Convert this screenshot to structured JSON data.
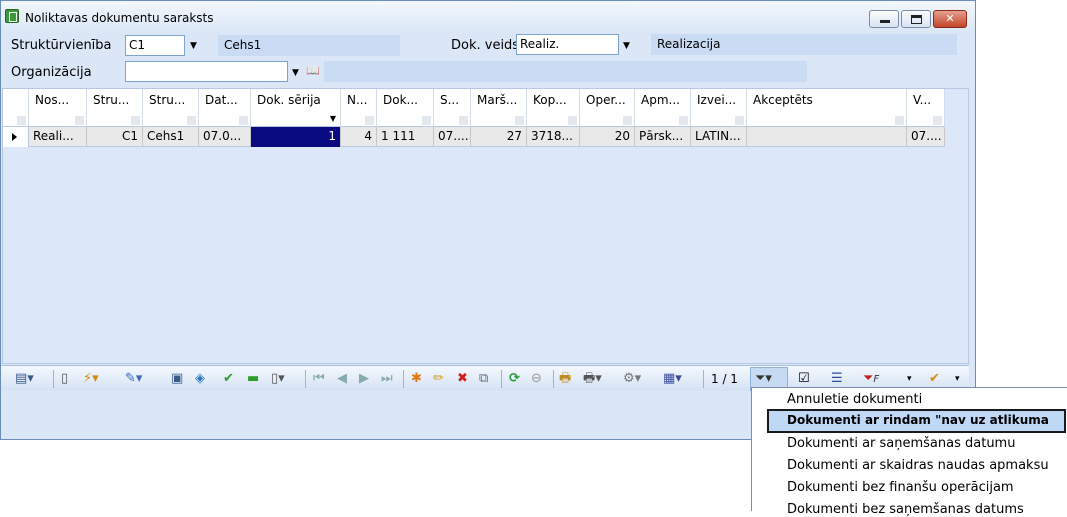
{
  "window": {
    "title": "Noliktavas dokumentu saraksts"
  },
  "form": {
    "struktur_label": "Struktūrvienība",
    "struktur_code": "C1",
    "struktur_name": "Cehs1",
    "dok_veids_label": "Dok. veids",
    "dok_veids_value": "Realiz.",
    "dok_veids_name": "Realizacija",
    "organizacija_label": "Organizācija",
    "organizacija_value": "",
    "organizacija_name": ""
  },
  "grid": {
    "columns": [
      "Nos...",
      "Stru...",
      "Stru...",
      "Dat...",
      "Dok. sērija",
      "N...",
      "Dok...",
      "S...",
      "Marš...",
      "Kop...",
      "Oper...",
      "Apm...",
      "Izvei...",
      "Akceptēts",
      "V..."
    ],
    "rows": [
      [
        "Reali...",
        "C1",
        "Cehs1",
        "07.0...",
        "1",
        "4",
        "1 111",
        "07....",
        "27",
        "3718...",
        "20",
        "Pārsk...",
        "LATIN...",
        "",
        "07...."
      ]
    ]
  },
  "toolbar": {
    "pager": "1 / 1"
  },
  "menu": {
    "items": [
      "Annuletie dokumenti",
      "Dokumenti ar rindam \"nav uz atlikuma",
      "Dokumenti ar saņemšanas datumu",
      "Dokumenti ar skaidras naudas apmaksu",
      "Dokumenti bez finanšu operācijam",
      "Dokumenti bez saņemšanas datums"
    ],
    "selected_index": 1
  }
}
